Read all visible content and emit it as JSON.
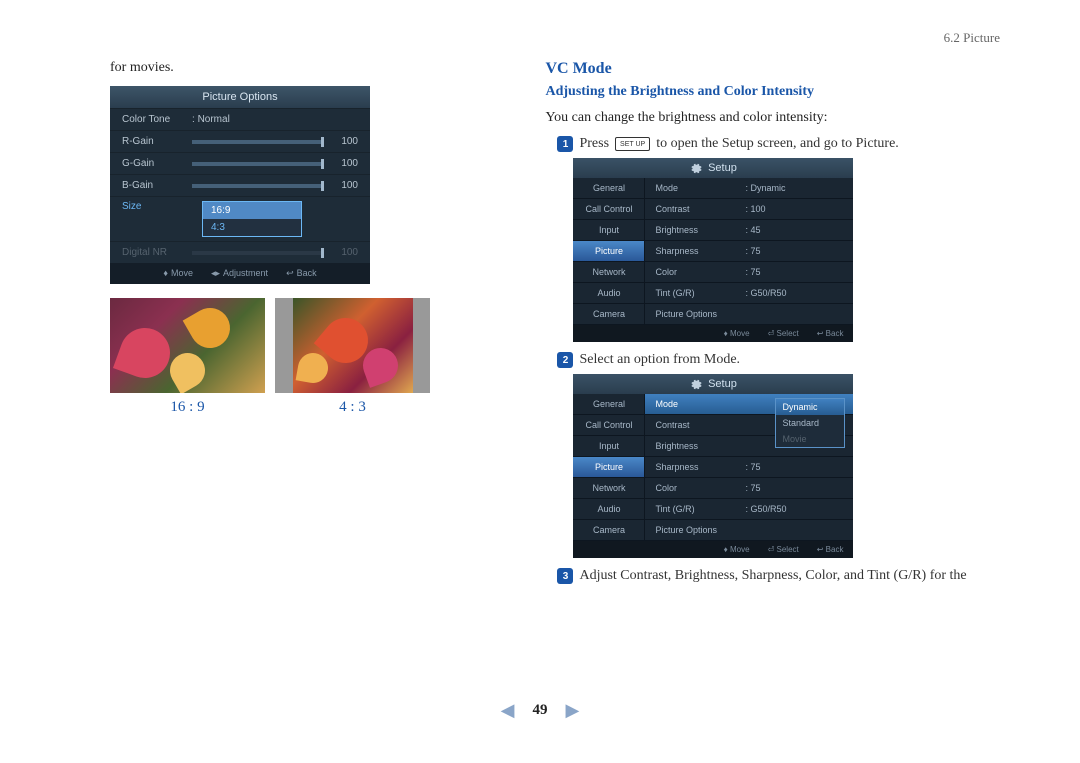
{
  "header": {
    "section_label": "6.2 Picture"
  },
  "left": {
    "intro": "for movies.",
    "picture_options": {
      "title": "Picture Options",
      "rows": [
        {
          "label": "Color Tone",
          "value": "Normal",
          "type": "text"
        },
        {
          "label": "R-Gain",
          "value": "100",
          "type": "slider"
        },
        {
          "label": "G-Gain",
          "value": "100",
          "type": "slider"
        },
        {
          "label": "B-Gain",
          "value": "100",
          "type": "slider"
        }
      ],
      "size_label": "Size",
      "size_options": [
        "16:9",
        "4:3"
      ],
      "digital_nr_label": "Digital NR",
      "digital_nr_value": "100",
      "footer": {
        "move": "Move",
        "adjust": "Adjustment",
        "back": "Back"
      }
    },
    "ratio_169": "16 : 9",
    "ratio_43": "4 : 3"
  },
  "right": {
    "heading": "VC Mode",
    "subheading": "Adjusting the Brightness and Color Intensity",
    "intro": "You can change the brightness and color intensity:",
    "step1_pre": "Press",
    "setup_key": "SET UP",
    "step1_post": "to open the Setup screen, and go to Picture.",
    "step2": "Select an option from Mode.",
    "step3": "Adjust Contrast, Brightness, Sharpness, Color, and Tint (G/R) for the",
    "setup": {
      "title": "Setup",
      "nav": [
        "General",
        "Call Control",
        "Input",
        "Picture",
        "Network",
        "Audio",
        "Camera"
      ],
      "list": [
        {
          "k": "Mode",
          "v": ": Dynamic"
        },
        {
          "k": "Contrast",
          "v": ": 100"
        },
        {
          "k": "Brightness",
          "v": ": 45"
        },
        {
          "k": "Sharpness",
          "v": ": 75"
        },
        {
          "k": "Color",
          "v": ": 75"
        },
        {
          "k": "Tint (G/R)",
          "v": ": G50/R50"
        },
        {
          "k": "Picture Options",
          "v": ""
        }
      ],
      "footer": {
        "move": "Move",
        "select": "Select",
        "back": "Back"
      },
      "mode_popup": [
        "Dynamic",
        "Standard",
        "Movie"
      ]
    }
  },
  "pager": {
    "num": "49"
  }
}
